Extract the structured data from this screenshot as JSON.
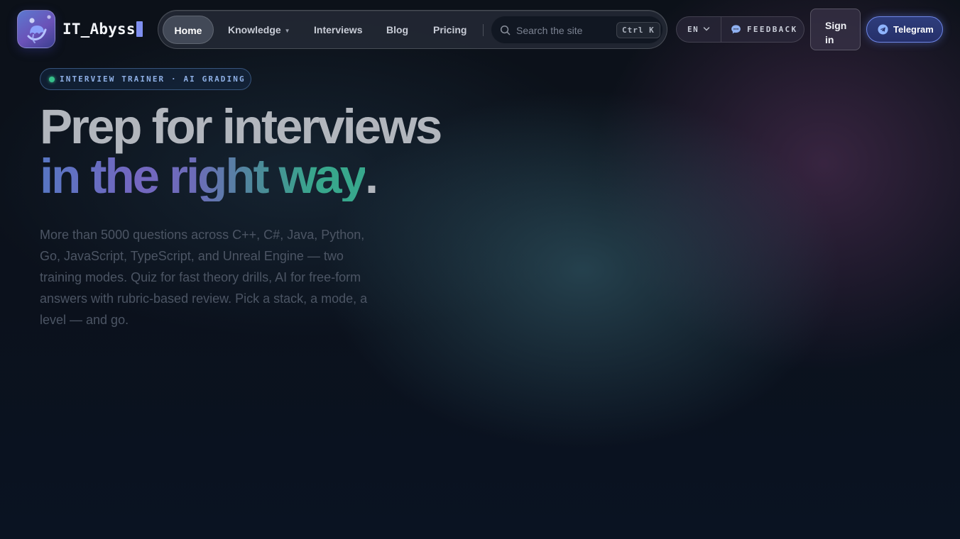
{
  "brand": {
    "name": "IT_Abyss",
    "logo_icon": "jellyfish-icon"
  },
  "nav": {
    "items": [
      {
        "label": "Home",
        "active": true
      },
      {
        "label": "Knowledge",
        "has_dropdown": true
      },
      {
        "label": "Interviews"
      },
      {
        "label": "Blog"
      },
      {
        "label": "Pricing"
      }
    ],
    "search": {
      "placeholder": "Search the site",
      "shortcut": "Ctrl K"
    }
  },
  "header_actions": {
    "language": "EN",
    "feedback_label": "FEEDBACK",
    "signin_label": "Sign in",
    "telegram_label": "Telegram"
  },
  "hero": {
    "badge": "INTERVIEW TRAINER · AI GRADING",
    "title_line1": "Prep for interviews",
    "title_line2": "in the right way",
    "title_dot": ".",
    "description": "More than 5000 questions across C++, C#, Java, Python, Go, JavaScript, TypeScript, and Unreal Engine — two training modes. Quiz for fast theory drills, AI for free-form answers with rubric-based review. Pick a stack, a mode, a level — and go."
  },
  "colors": {
    "accent_blue": "#6f87e8",
    "badge_dot": "#36c08a",
    "gradient_start": "#5776c2",
    "gradient_mid": "#7467c0",
    "gradient_end": "#38a78c"
  }
}
